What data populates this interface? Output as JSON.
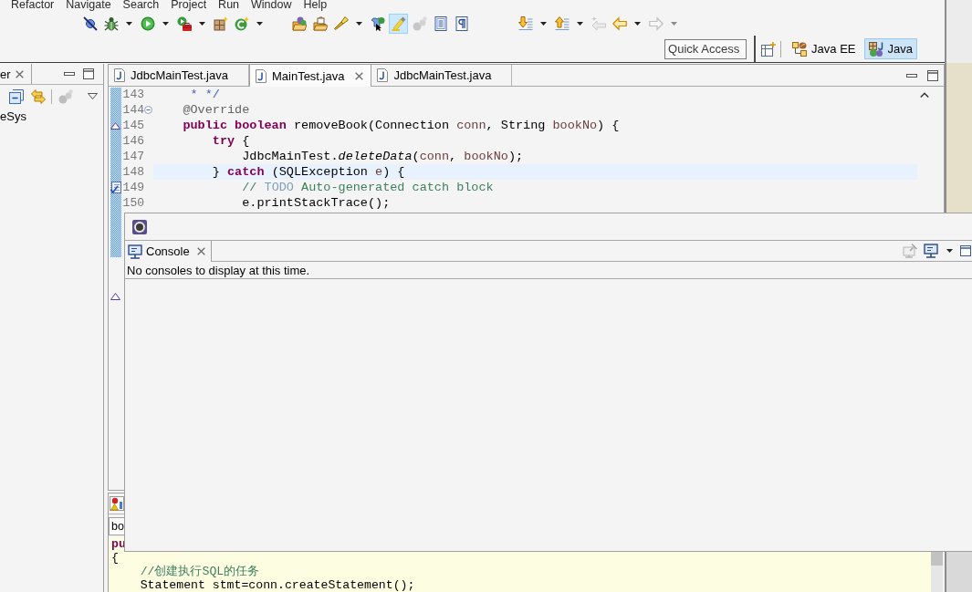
{
  "menu": [
    "Refactor",
    "Navigate",
    "Search",
    "Project",
    "Run",
    "Window",
    "Help"
  ],
  "toolbar": [
    {
      "items": [
        {
          "on": false,
          "disabled": false,
          "dropdown": false
        },
        {
          "on": false,
          "disabled": false,
          "dropdown": true
        },
        {
          "on": false,
          "disabled": false,
          "dropdown": true
        },
        {
          "on": false,
          "disabled": false,
          "dropdown": true
        },
        {
          "on": false,
          "disabled": false,
          "dropdown": false
        },
        {
          "on": false,
          "disabled": false,
          "dropdown": true
        }
      ]
    },
    {
      "items": [
        {
          "on": false,
          "disabled": false,
          "dropdown": false
        },
        {
          "on": false,
          "disabled": false,
          "dropdown": false
        },
        {
          "on": false,
          "disabled": false,
          "dropdown": true
        },
        {
          "on": false,
          "disabled": false,
          "dropdown": false
        },
        {
          "on": true,
          "disabled": false,
          "dropdown": false
        },
        {
          "on": false,
          "disabled": true,
          "dropdown": false
        },
        {
          "on": false,
          "disabled": false,
          "dropdown": false
        },
        {
          "on": false,
          "disabled": false,
          "dropdown": false
        }
      ]
    },
    {
      "items": [
        {
          "on": false,
          "disabled": false,
          "dropdown": true
        },
        {
          "on": false,
          "disabled": false,
          "dropdown": true
        },
        {
          "on": false,
          "disabled": true,
          "dropdown": false
        },
        {
          "on": false,
          "disabled": false,
          "dropdown": true
        },
        {
          "on": false,
          "disabled": true,
          "dropdown": true
        }
      ]
    }
  ],
  "quick_access": {
    "placeholder": "Quick Access"
  },
  "perspectives": [
    {
      "label": "Java EE",
      "selected": false
    },
    {
      "label": "Java",
      "selected": true
    }
  ],
  "left_view": {
    "tab": {
      "label": "er"
    },
    "toolbar": [
      {
        "disabled": false
      },
      {
        "disabled": false
      },
      {
        "disabled": true
      },
      {
        "disabled": false
      }
    ],
    "tree": [
      {
        "label": "eSys",
        "selected": false
      }
    ]
  },
  "editor": {
    "tabs": [
      {
        "label": "JdbcMainTest.java",
        "selected": false
      },
      {
        "label": "MainTest.java",
        "selected": true
      },
      {
        "label": "JdbcMainTest.java",
        "selected": false
      }
    ],
    "lines": [
      {
        "number": "143",
        "current": false,
        "foldable": false,
        "tokens": [
          {
            "kind": "javadoc",
            "text": "     * */"
          }
        ]
      },
      {
        "number": "144",
        "current": false,
        "foldable": true,
        "tokens": [
          {
            "kind": "annotation",
            "text": "    @Override"
          }
        ]
      },
      {
        "number": "145",
        "current": false,
        "foldable": false,
        "marker": {
          "kind": "override"
        },
        "tokens": [
          {
            "kind": "keyword",
            "text": "    public boolean"
          },
          {
            "kind": "plain",
            "text": " removeBook(Connection "
          },
          {
            "kind": "variable",
            "text": "conn"
          },
          {
            "kind": "plain",
            "text": ", String "
          },
          {
            "kind": "variable",
            "text": "bookNo"
          },
          {
            "kind": "plain",
            "text": ") {"
          }
        ]
      },
      {
        "number": "146",
        "current": false,
        "foldable": false,
        "tokens": [
          {
            "kind": "keyword",
            "text": "        try"
          },
          {
            "kind": "plain",
            "text": " {"
          }
        ]
      },
      {
        "number": "147",
        "current": false,
        "foldable": false,
        "tokens": [
          {
            "kind": "plain",
            "text": "            JdbcMainTest."
          },
          {
            "kind": "static_method",
            "text": "deleteData"
          },
          {
            "kind": "plain",
            "text": "("
          },
          {
            "kind": "variable",
            "text": "conn"
          },
          {
            "kind": "plain",
            "text": ", "
          },
          {
            "kind": "variable",
            "text": "bookNo"
          },
          {
            "kind": "plain",
            "text": ");"
          }
        ]
      },
      {
        "number": "148",
        "current": true,
        "foldable": false,
        "tokens": [
          {
            "kind": "plain",
            "text": "        } "
          },
          {
            "kind": "keyword",
            "text": "catch"
          },
          {
            "kind": "plain",
            "text": " (SQLException "
          },
          {
            "kind": "variable",
            "text": "e"
          },
          {
            "kind": "plain",
            "text": ") {"
          }
        ]
      },
      {
        "number": "149",
        "current": false,
        "foldable": false,
        "marker": {
          "kind": "task"
        },
        "tokens": [
          {
            "kind": "comment",
            "text": "            // "
          },
          {
            "kind": "todo",
            "text": "TODO"
          },
          {
            "kind": "comment",
            "text": " Auto-generated catch block"
          }
        ]
      },
      {
        "number": "150",
        "current": false,
        "foldable": false,
        "tokens": [
          {
            "kind": "plain",
            "text": "            e.printStackTrace();"
          }
        ]
      }
    ],
    "offscreen_marker": {
      "kind": "override"
    }
  },
  "console": {
    "tab": {
      "label": "Console"
    },
    "toolbar": [
      {
        "disabled": true,
        "dropdown": false
      },
      {
        "disabled": false,
        "dropdown": true
      },
      {
        "disabled": false,
        "dropdown": false
      }
    ],
    "message": "No consoles to display at this time."
  },
  "bottom_view": {
    "title_field": "bo",
    "lines": [
      {
        "tokens": [
          {
            "kind": "keyword",
            "text": "pu"
          }
        ]
      },
      {
        "tokens": [
          {
            "kind": "plain",
            "text": "{"
          }
        ]
      },
      {
        "tokens": [
          {
            "kind": "comment",
            "text": "    //创建执行SQL的任务"
          }
        ]
      },
      {
        "tokens": [
          {
            "kind": "plain",
            "text": "    Statement stmt=conn.createStatement();"
          }
        ]
      }
    ]
  }
}
